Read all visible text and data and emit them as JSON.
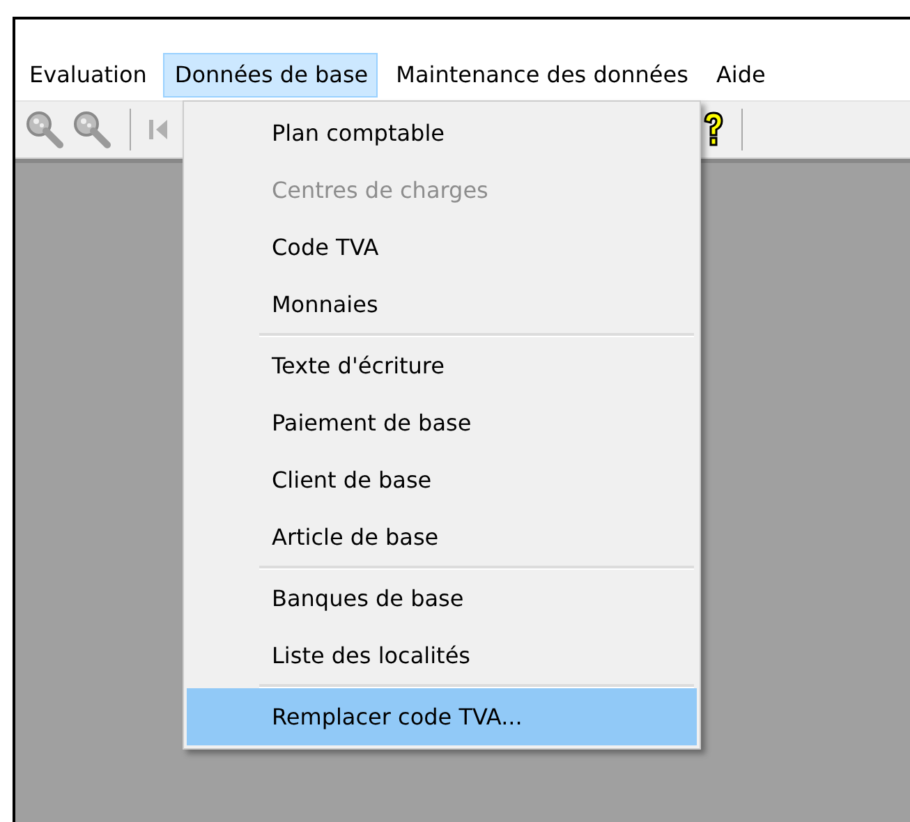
{
  "menu_bar": [
    {
      "label": "Evaluation",
      "selected": false
    },
    {
      "label": "Données de base",
      "selected": true
    },
    {
      "label": "Maintenance des données",
      "selected": false
    },
    {
      "label": "Aide",
      "selected": false
    }
  ],
  "dropdown": [
    {
      "kind": "item",
      "label": "Plan comptable",
      "disabled": false,
      "selected": false
    },
    {
      "kind": "item",
      "label": "Centres de charges",
      "disabled": true,
      "selected": false
    },
    {
      "kind": "item",
      "label": "Code TVA",
      "disabled": false,
      "selected": false
    },
    {
      "kind": "item",
      "label": "Monnaies",
      "disabled": false,
      "selected": false
    },
    {
      "kind": "separator"
    },
    {
      "kind": "item",
      "label": "Texte d'écriture",
      "disabled": false,
      "selected": false
    },
    {
      "kind": "item",
      "label": "Paiement de base",
      "disabled": false,
      "selected": false
    },
    {
      "kind": "item",
      "label": "Client de base",
      "disabled": false,
      "selected": false
    },
    {
      "kind": "item",
      "label": "Article de base",
      "disabled": false,
      "selected": false
    },
    {
      "kind": "separator"
    },
    {
      "kind": "item",
      "label": "Banques de base",
      "disabled": false,
      "selected": false
    },
    {
      "kind": "item",
      "label": "Liste des localités",
      "disabled": false,
      "selected": false
    },
    {
      "kind": "separator"
    },
    {
      "kind": "item",
      "label": "Remplacer code TVA...",
      "disabled": false,
      "selected": true
    }
  ]
}
